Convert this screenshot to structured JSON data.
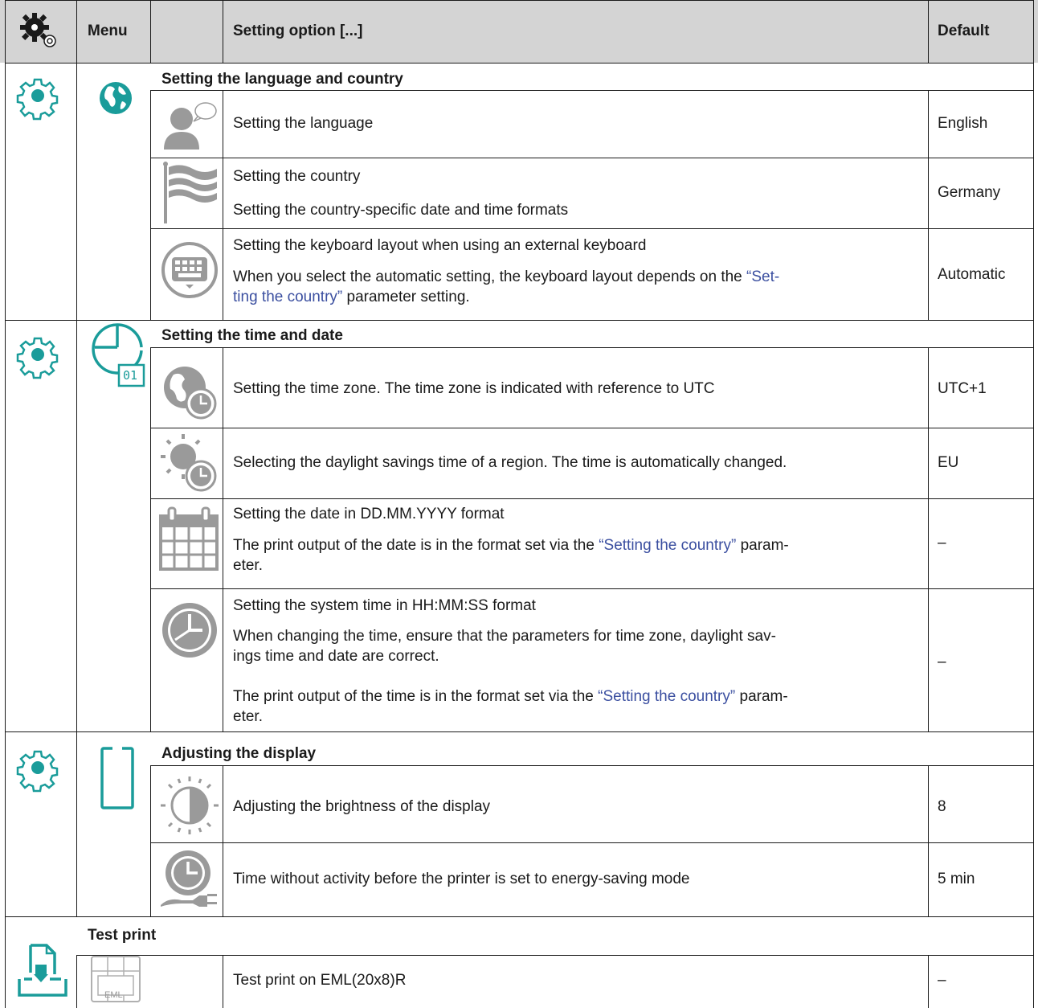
{
  "header": {
    "menu": "Menu",
    "option": "Setting option  [...]",
    "default": "Default"
  },
  "sections": {
    "lang": {
      "title": "Setting the language and country",
      "language": {
        "text": "Setting the language",
        "default": "English"
      },
      "country": {
        "line1": "Setting the country",
        "line2": "Setting the country-specific date and time formats",
        "default": "Germany"
      },
      "keyboard": {
        "line1": "Setting the keyboard layout when using an external keyboard",
        "line2a": "When you select the automatic setting, the keyboard layout depends on the ",
        "link_a": "“Set-",
        "link_b": "ting the country”",
        "line3": " parameter setting.",
        "default": "Automatic"
      }
    },
    "time": {
      "title": "Setting the time and date",
      "icon_text": "01",
      "zone": {
        "text": "Setting the time zone. The time zone is indicated with reference to UTC",
        "default": "UTC+1"
      },
      "dst": {
        "text": "Selecting the daylight savings time of a region. The time is automatically changed.",
        "default": "EU"
      },
      "date": {
        "line1": "Setting the date in DD.MM.YYYY format",
        "line2a": "The print output of the date is in the format set via the ",
        "link": "“Setting the country”",
        "line2b": " param-",
        "line3": "eter.",
        "default": "–"
      },
      "systime": {
        "line1": "Setting the system time in HH:MM:SS format",
        "line2": "When changing the time, ensure that the parameters for time zone, daylight sav-",
        "line3": "ings time and date are correct.",
        "line4a": "The print output of the time is in the format set via the ",
        "link": "“Setting the country”",
        "line4b": " param-",
        "line5": "eter.",
        "default": "–"
      }
    },
    "display": {
      "title": "Adjusting the display",
      "brightness": {
        "text": "Adjusting the brightness of the display",
        "default": "8"
      },
      "energy": {
        "text": "Time without activity before the printer is set to energy-saving mode",
        "default": "5 min"
      }
    },
    "test": {
      "title": "Test print",
      "icon_text": "EML",
      "item": {
        "text": "Test print on EML(20x8)R",
        "default": "–"
      }
    }
  },
  "icons": {
    "header": "settings-gear-icon",
    "gear": "gear-outline-icon",
    "globe": "globe-icon",
    "speech": "user-speech-icon",
    "flag": "flag-icon",
    "keyboard": "keyboard-icon",
    "clock_date": "clock-calendar-icon",
    "tz": "time-zone-icon",
    "dst": "daylight-savings-icon",
    "calendar": "calendar-icon",
    "clock": "clock-icon",
    "display": "display-icon",
    "brightness": "brightness-icon",
    "energy": "energy-saving-icon",
    "testprint": "test-print-icon",
    "label": "eml-label-icon"
  },
  "colors": {
    "accent": "#1a9c9a",
    "header_bg": "#d4d4d4",
    "link": "#3b4fa0",
    "icon_gray": "#9a9a9a"
  }
}
